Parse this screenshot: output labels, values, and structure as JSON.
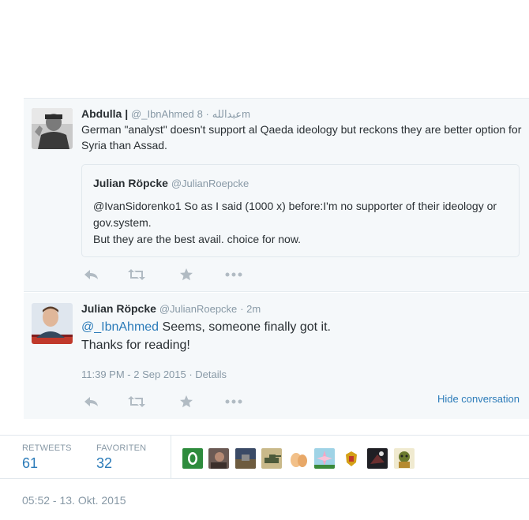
{
  "tweets": [
    {
      "fullname": "Abdulla |",
      "username": "@_IbnAhmed",
      "arabic_name": "عبدالله",
      "timestamp": "· 8m",
      "text": "German \"analyst\" doesn't support al Qaeda ideology but reckons they are better option for Syria than Assad.",
      "quote": {
        "fullname": "Julian Röpcke",
        "username": "@JulianRoepcke",
        "line1": "@IvanSidorenko1 So as I said (1000 x) before:I'm no supporter of their ideology or gov.system.",
        "line2": "But they are the best avail. choice for now."
      }
    },
    {
      "fullname": "Julian Röpcke",
      "username": "@JulianRoepcke",
      "timestamp": "· 2m",
      "mention": "@_IbnAhmed",
      "text_rest": " Seems, someone finally got it.",
      "text_line2": "Thanks for reading!",
      "meta": "11:39 PM - 2 Sep 2015 · Details",
      "hide_conversation": "Hide conversation"
    }
  ],
  "stats": {
    "retweets_label": "RETWEETS",
    "retweets_value": "61",
    "favorites_label": "FAVORITEN",
    "favorites_value": "32"
  },
  "bottom_timestamp": "05:52 - 13. Okt. 2015",
  "colors": {
    "link": "#2b7bb9",
    "muted": "#8899a6",
    "action_icon": "#b1bbc3",
    "background": "#f5f8fa"
  },
  "icons": {
    "reply": "reply-icon",
    "retweet": "retweet-icon",
    "favorite": "star-icon",
    "more": "more-icon"
  }
}
